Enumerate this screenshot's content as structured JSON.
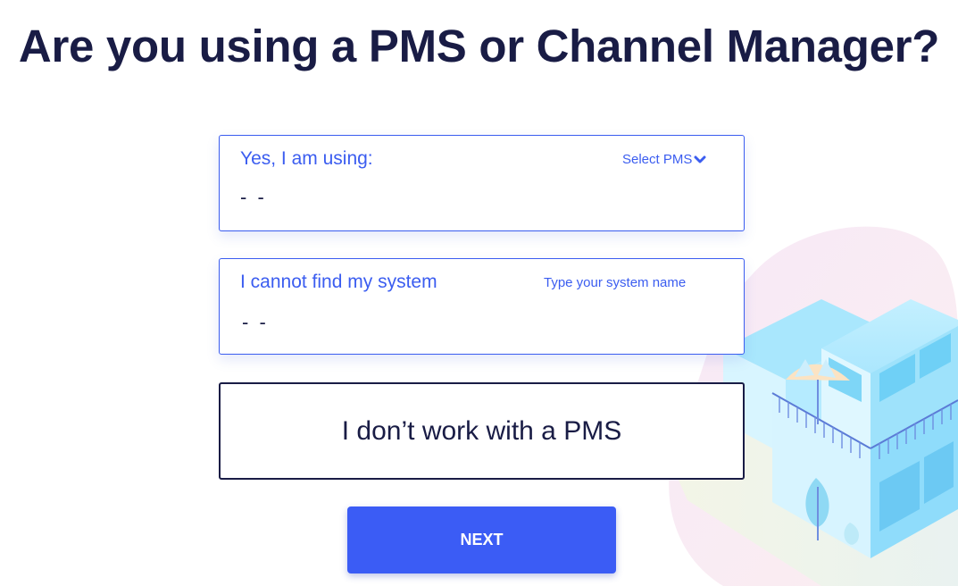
{
  "page": {
    "title": "Are you using a PMS or Channel Manager?"
  },
  "options": {
    "pms": {
      "label": "Yes, I am using:",
      "action_label": "Select PMS",
      "action_icon": "chevron-down-icon",
      "value": "- -"
    },
    "other_system": {
      "label": "I cannot find my system",
      "action_label": "Type your system name",
      "value": "- -"
    },
    "no_pms": {
      "label": "I don’t work with a PMS"
    }
  },
  "next_button": {
    "label": "NEXT"
  },
  "colors": {
    "title": "#191c45",
    "accent": "#3b5df0",
    "button": "#3b5cf5"
  }
}
